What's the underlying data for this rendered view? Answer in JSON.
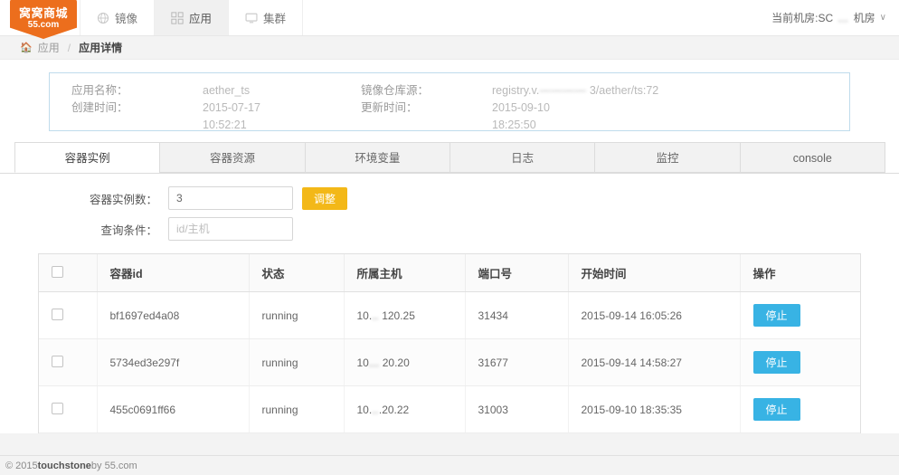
{
  "navbar": {
    "logo": {
      "line1": "窝窝商城",
      "line2": "55.com",
      "color": "#ec6e1d"
    },
    "items": [
      {
        "label": "镜像",
        "icon": "globe-icon",
        "active": false
      },
      {
        "label": "应用",
        "icon": "grid-icon",
        "active": true
      },
      {
        "label": "集群",
        "icon": "monitor-icon",
        "active": false
      }
    ],
    "datacenter_selector": {
      "label": "当前机房:SC",
      "redacted": "…",
      "suffix": "机房",
      "caret": "∨"
    }
  },
  "breadcrumb": {
    "home_icon": "home-icon",
    "parent": "应用",
    "separator": "/",
    "current": "应用详情"
  },
  "info_panel": {
    "border_color": "#bfdcec",
    "fields": [
      {
        "label": "应用名称：",
        "value": "aether_ts"
      },
      {
        "label": "镜像仓库源：",
        "value_prefix": "registry.v.",
        "value_redacted": "————",
        "value_suffix": "3/aether/ts:72"
      },
      {
        "label": "创建时间：",
        "value_line1": "2015-07-17",
        "value_line2": "10:52:21"
      },
      {
        "label": "更新时间：",
        "value_line1": "2015-09-10",
        "value_line2": "18:25:50"
      }
    ]
  },
  "tabs": [
    {
      "label": "容器实例",
      "active": true
    },
    {
      "label": "容器资源",
      "active": false
    },
    {
      "label": "环境变量",
      "active": false
    },
    {
      "label": "日志",
      "active": false
    },
    {
      "label": "监控",
      "active": false
    },
    {
      "label": "console",
      "active": false
    }
  ],
  "form": {
    "instance_count": {
      "label": "容器实例数：",
      "value": "3",
      "placeholder": ""
    },
    "adjust_button": {
      "label": "调整",
      "color": "#f3b818"
    },
    "query": {
      "label": "查询条件：",
      "value": "",
      "placeholder": "id/主机"
    }
  },
  "table": {
    "headers": [
      "",
      "容器id",
      "状态",
      "所属主机",
      "端口号",
      "开始时间",
      "操作"
    ],
    "action_label": "停止",
    "action_color": "#38b3e4",
    "rows": [
      {
        "id": "bf1697ed4a08",
        "status": "running",
        "host_prefix": "10.",
        "host_suffix": "120.25",
        "port": "31434",
        "start_time": "2015-09-14 16:05:26",
        "action": "停止"
      },
      {
        "id": "5734ed3e297f",
        "status": "running",
        "host_prefix": "10",
        "host_suffix": "20.20",
        "port": "31677",
        "start_time": "2015-09-14 14:58:27",
        "action": "停止"
      },
      {
        "id": "455c0691ff66",
        "status": "running",
        "host_prefix": "10.",
        "host_suffix": ".20.22",
        "port": "31003",
        "start_time": "2015-09-10 18:35:35",
        "action": "停止"
      }
    ]
  },
  "footer": {
    "copyright": "© 2015 ",
    "brand": "touchstone",
    "by": " by 55.com"
  }
}
